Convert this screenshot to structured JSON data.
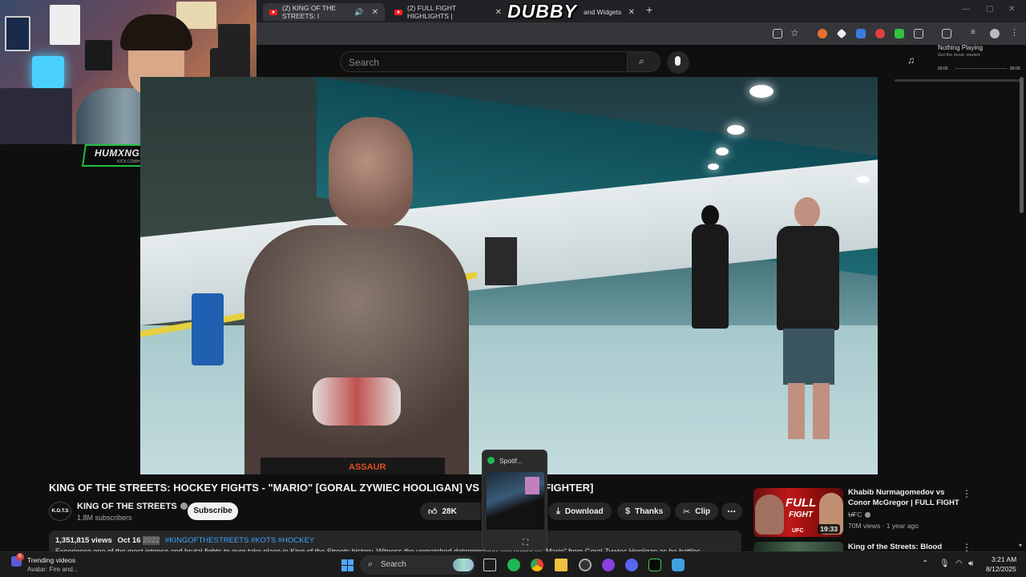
{
  "browser": {
    "tabs": [
      {
        "label": "(2) KING OF THE STREETS: I",
        "active": true
      },
      {
        "label": "(2) FULL FIGHT HIGHLIGHTS |  ",
        "active": false
      },
      {
        "label": "and Widgets",
        "active": false
      }
    ]
  },
  "overlay": {
    "watermark": "DUBBY",
    "streamer_name": "HUMXNGHXST",
    "streamer_sub": "KICK.COM/HUMXNGHXST"
  },
  "youtube": {
    "search_placeholder": "Search"
  },
  "now_playing": {
    "title": "Nothing Playing",
    "subtitle": "Get the music started",
    "time_start": "00:00",
    "time_end": "00:00"
  },
  "video": {
    "title": "KING OF THE STREETS: HOCKEY FIGHTS - \"MARIO\" [GORAL ZYWIEC HOOLIGAN] VS \"HAM",
    "title_end": "FIGHTER]",
    "shorts_text": "ASSAUR",
    "channel": {
      "avatar_text": "K.O.T.S",
      "name": "KING OF THE STREETS",
      "subscribers": "1.8M subscribers"
    },
    "subscribe_label": "Subscribe",
    "actions": {
      "likes": "28K",
      "download": "Download",
      "thanks": "Thanks",
      "clip": "Clip"
    },
    "description": {
      "views": "1,351,815 views",
      "date": "Oct 16",
      "year": "2022",
      "hashtags": "#KINGOFTHESTREETS #KOTS #HOCKEY",
      "text": "Experience one of the most intense and brutal fights to ever take place in King of the Streets history. Witness the unmatched determination and power of \"Mario\" from Goral Zywiec Hooligan as he battles"
    }
  },
  "recommended": [
    {
      "title": "Khabib Nurmagomedov vs Conor McGregor | FULL FIGHT ...",
      "channel": "UFC",
      "meta": "70M views · 1 year ago",
      "duration": "19:33",
      "thumb_text_1": "FULL",
      "thumb_text_2": "FIGHT",
      "thumb_logo": "UFC"
    },
    {
      "title": "King of the Streets: Blood"
    }
  ],
  "spotify_preview": {
    "label": "Spotif..."
  },
  "taskbar": {
    "widget_badge": "6",
    "widget_title": "Trending videos",
    "widget_sub": "Avatar: Fire and...",
    "search_label": "Search",
    "time": "3:21 AM",
    "date": "8/12/2025"
  },
  "colors": {
    "youtube_bg": "#0f0f0f",
    "link_blue": "#3ea6ff",
    "spotify_green": "#1db954",
    "kick_green": "#20c040"
  }
}
